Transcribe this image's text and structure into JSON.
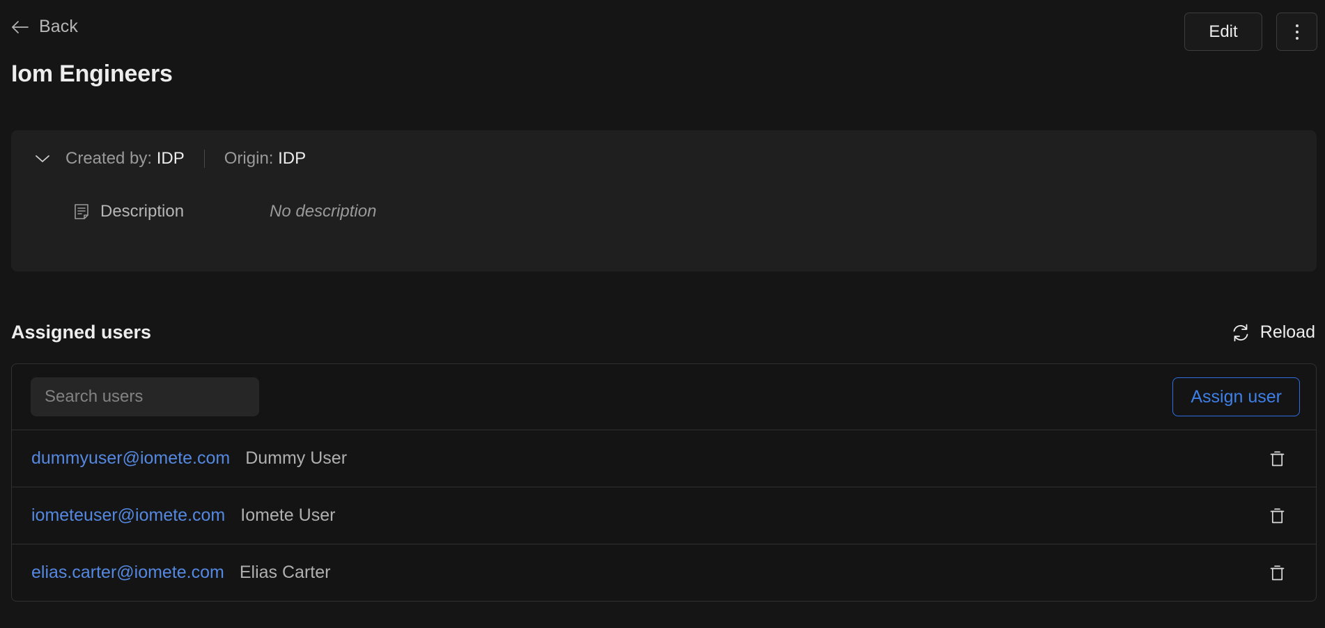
{
  "header": {
    "back_label": "Back",
    "back_icon": "arrow-left-icon",
    "edit_label": "Edit",
    "kebab_icon": "more-vertical-icon"
  },
  "page_title": "Iom Engineers",
  "info_card": {
    "chevron_icon": "chevron-down-icon",
    "created_by_label": "Created by:",
    "created_by_value": "IDP",
    "origin_label": "Origin:",
    "origin_value": "IDP",
    "description_icon": "document-icon",
    "description_label": "Description",
    "description_value": "No description"
  },
  "assigned_users": {
    "section_title": "Assigned users",
    "reload_label": "Reload",
    "reload_icon": "refresh-icon",
    "search_placeholder": "Search users",
    "search_value": "",
    "assign_label": "Assign user",
    "delete_icon": "trash-icon",
    "rows": [
      {
        "email": "dummyuser@iomete.com",
        "name": "Dummy User"
      },
      {
        "email": "iometeuser@iomete.com",
        "name": "Iomete User"
      },
      {
        "email": "elias.carter@iomete.com",
        "name": "Elias Carter"
      }
    ]
  },
  "colors": {
    "page_background": "#151515",
    "card_background": "#1f1f1f",
    "accent_blue": "#3f7fe8",
    "link_blue": "#5588e0",
    "border": "#313131",
    "text_primary": "#ededed",
    "text_secondary": "#9a9a9a"
  }
}
